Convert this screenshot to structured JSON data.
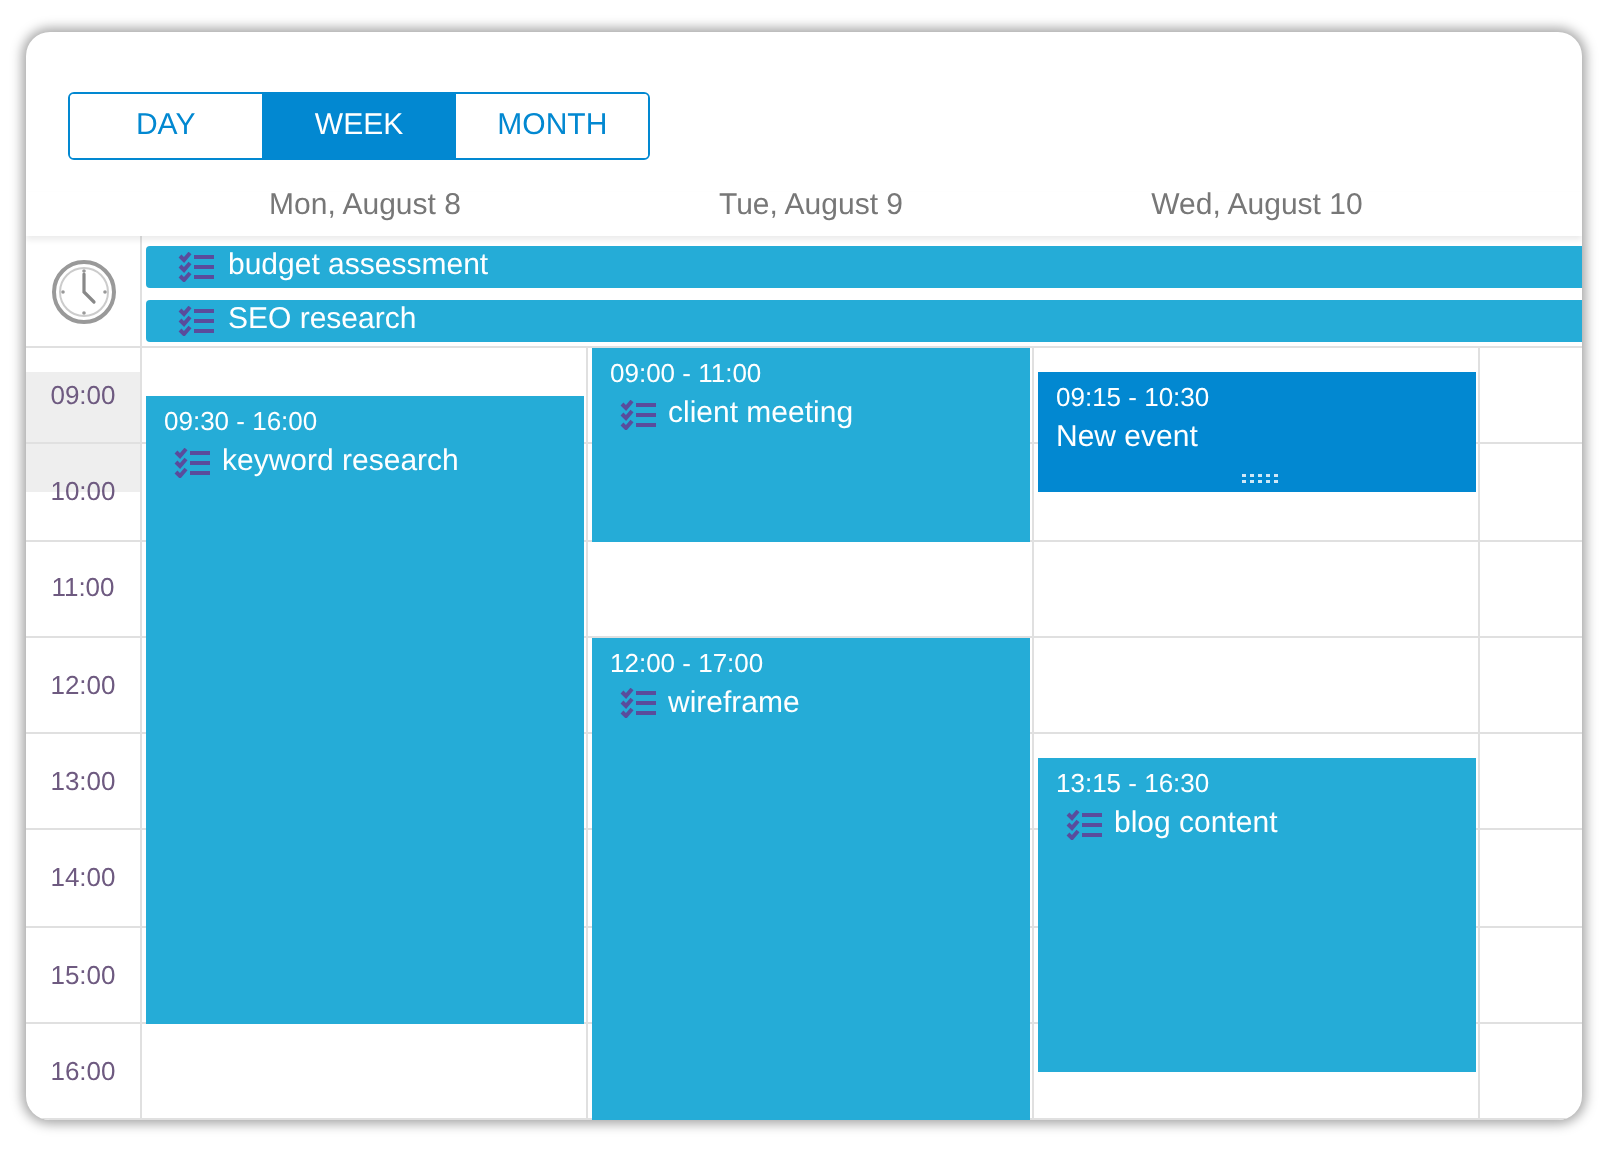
{
  "view_switcher": [
    {
      "label": "DAY",
      "selected": false
    },
    {
      "label": "WEEK",
      "selected": true
    },
    {
      "label": "MONTH",
      "selected": false
    }
  ],
  "all_day_events": [
    {
      "title": "budget assessment",
      "kind": "task"
    },
    {
      "title": "SEO research",
      "kind": "task"
    }
  ],
  "hours": [
    "09:00",
    "10:00",
    "11:00",
    "12:00",
    "13:00",
    "14:00",
    "15:00",
    "16:00"
  ],
  "days": [
    {
      "label": "Mon, August 8",
      "events": [
        {
          "time": "09:30 - 16:00",
          "title": "keyword research",
          "kind": "task",
          "selected": false
        }
      ]
    },
    {
      "label": "Tue, August 9",
      "events": [
        {
          "time": "09:00 - 11:00",
          "title": "client meeting",
          "kind": "task",
          "selected": false
        },
        {
          "time": "12:00 - 17:00",
          "title": "wireframe",
          "kind": "task",
          "selected": false
        }
      ]
    },
    {
      "label": "Wed, August 10",
      "events": [
        {
          "time": "09:15 - 10:30",
          "title": "New event",
          "kind": "plain",
          "selected": true
        },
        {
          "time": "13:15 - 16:30",
          "title": "blog content",
          "kind": "task",
          "selected": false
        }
      ]
    }
  ]
}
